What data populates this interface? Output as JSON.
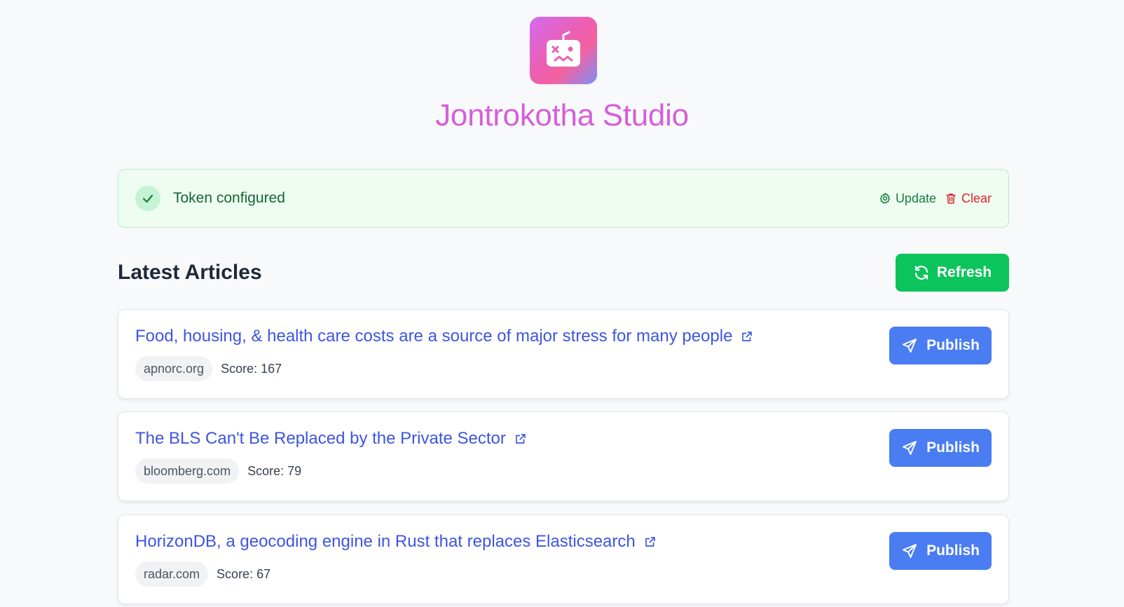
{
  "header": {
    "app_title": "Jontrokotha Studio",
    "logo_icon": "robot-face-icon",
    "title_color": "#d55fd9"
  },
  "token_banner": {
    "status": "Token configured",
    "status_icon": "check-icon",
    "update_label": "Update",
    "update_icon": "gear-icon",
    "clear_label": "Clear",
    "clear_icon": "trash-icon"
  },
  "articles_section": {
    "title": "Latest Articles",
    "refresh_label": "Refresh",
    "refresh_icon": "refresh-icon"
  },
  "articles": [
    {
      "title": "Food, housing, & health care costs are a source of major stress for many people",
      "domain": "apnorc.org",
      "score": "Score: 167",
      "publish_label": "Publish"
    },
    {
      "title": "The BLS Can't Be Replaced by the Private Sector",
      "domain": "bloomberg.com",
      "score": "Score: 79",
      "publish_label": "Publish"
    },
    {
      "title": "HorizonDB, a geocoding engine in Rust that replaces Elasticsearch",
      "domain": "radar.com",
      "score": "Score: 67",
      "publish_label": "Publish"
    }
  ],
  "colors": {
    "accent_green": "#0bc45b",
    "publish_blue": "#4a7cf2",
    "link_blue": "#3e55e0",
    "danger_red": "#dc2626",
    "banner_bg": "#eefcf2"
  }
}
